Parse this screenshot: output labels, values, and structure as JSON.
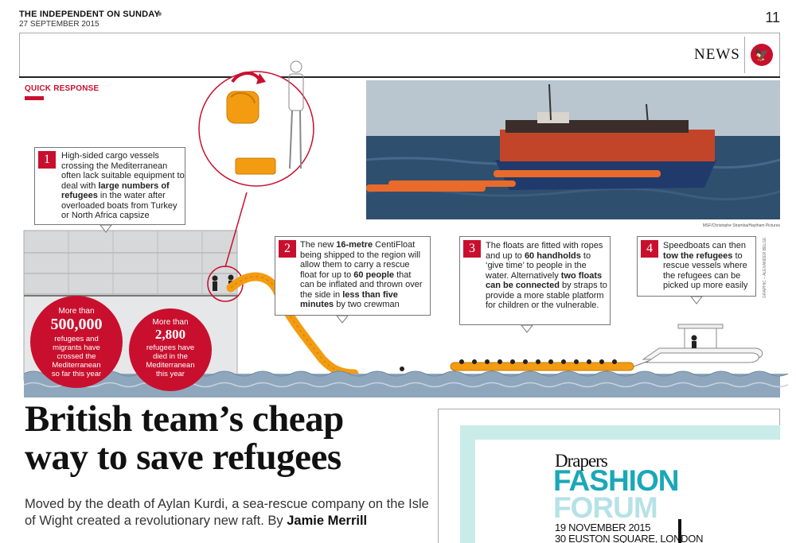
{
  "masthead": {
    "paper": "THE INDEPENDENT ON SUNDAY",
    "date": "27 SEPTEMBER 2015",
    "page_number": "11"
  },
  "section": {
    "label": "NEWS"
  },
  "graphic": {
    "kicker": "QUICK RESPONSE",
    "photo_credit": "MSF/Christophe Stramba/Haytham Pictures",
    "graphic_credit": "GRAPHIC – ALEXANDER BELGE",
    "callouts": [
      {
        "number": "1",
        "parts": [
          {
            "t": "High-sided cargo vessels crossing the Mediterranean often lack suitable equipment to deal with ",
            "b": false
          },
          {
            "t": "large numbers of refugees",
            "b": true
          },
          {
            "t": " in the water after overloaded boats from Turkey or North Africa capsize",
            "b": false
          }
        ]
      },
      {
        "number": "2",
        "parts": [
          {
            "t": "The new ",
            "b": false
          },
          {
            "t": "16-metre",
            "b": true
          },
          {
            "t": " CentiFloat being shipped to the region will allow them to carry a rescue float for up to ",
            "b": false
          },
          {
            "t": "60 people",
            "b": true
          },
          {
            "t": " that can be inflated and thrown over the side in ",
            "b": false
          },
          {
            "t": "less than five minutes",
            "b": true
          },
          {
            "t": " by two crewman",
            "b": false
          }
        ]
      },
      {
        "number": "3",
        "parts": [
          {
            "t": "The floats are fitted with ropes and up to ",
            "b": false
          },
          {
            "t": "60 handholds",
            "b": true
          },
          {
            "t": " to ‘give time’ to people in the water. Alternatively ",
            "b": false
          },
          {
            "t": "two floats can be connected",
            "b": true
          },
          {
            "t": " by straps to provide a more stable platform for children or the vulnerable.",
            "b": false
          }
        ]
      },
      {
        "number": "4",
        "parts": [
          {
            "t": "Speedboats can then ",
            "b": false
          },
          {
            "t": "tow the refugees",
            "b": true
          },
          {
            "t": " to rescue vessels where the refugees can be picked up more easily",
            "b": false
          }
        ]
      }
    ],
    "stats": [
      {
        "pre": "More than",
        "big": "500,000",
        "post": "refugees and\nmigrants have\ncrossed the\nMediterranean\nso far this year"
      },
      {
        "pre": "More than",
        "big": "2,800",
        "post": "refugees have\ndied in the\nMediterranean\nthis year"
      }
    ]
  },
  "article": {
    "headline": "British team’s cheap\nway to save refugees",
    "standfirst": "Moved by the death of Aylan Kurdi, a sea-rescue company on the Isle of Wight created a revolutionary new raft. By ",
    "byline": "Jamie Merrill"
  },
  "advert": {
    "brand": "Drapers",
    "line1": "FASHION",
    "line2": "FORUM",
    "date": "19 NOVEMBER 2015",
    "venue": "30 EUSTON SQUARE, LONDON"
  },
  "colors": {
    "accent_red": "#c8102e",
    "ad_teal": "#1aa8b8",
    "ad_light_teal": "#b6e2e6",
    "sea": "#8fa7bd"
  }
}
